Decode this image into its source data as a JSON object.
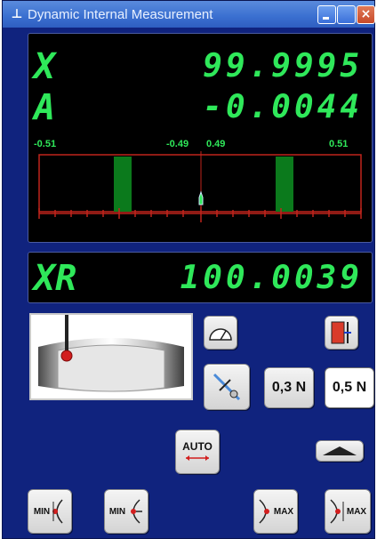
{
  "window": {
    "title": "Dynamic Internal Measurement",
    "title_icon": "probe-icon",
    "close_glyph": "×"
  },
  "display": {
    "axis_1": {
      "label": "X",
      "value": "99.9995"
    },
    "axis_2": {
      "label": "A",
      "value": "-0.0044"
    },
    "scale": {
      "left_min": "-0.51",
      "left_max": "-0.49",
      "right_min": "0.49",
      "right_max": "0.51"
    }
  },
  "result": {
    "label": "XR",
    "value": "100.0039"
  },
  "buttons": {
    "force_low": "0,3 N",
    "force_high": "0,5 N",
    "auto": "AUTO",
    "min_1": "MIN",
    "min_2": "MIN",
    "max_1": "MAX",
    "max_2": "MAX"
  },
  "colors": {
    "window_bg": "#10237e",
    "lcd_green": "#2fe85a",
    "scale_red": "#c0241c",
    "tolerance_band": "#0b7a1c"
  }
}
